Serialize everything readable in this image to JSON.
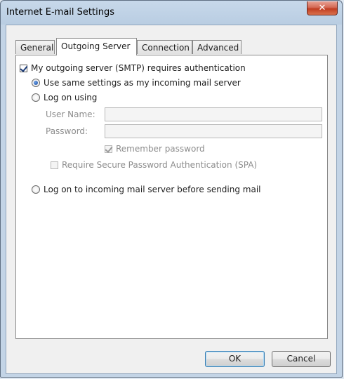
{
  "window": {
    "title": "Internet E-mail Settings",
    "close_glyph": "✕"
  },
  "tabs": [
    {
      "label": "General",
      "active": false
    },
    {
      "label": "Outgoing Server",
      "active": true
    },
    {
      "label": "Connection",
      "active": false
    },
    {
      "label": "Advanced",
      "active": false
    }
  ],
  "outgoing": {
    "smtp_auth": {
      "label": "My outgoing server (SMTP) requires authentication",
      "checked": true
    },
    "same_settings": {
      "label": "Use same settings as my incoming mail server",
      "selected": true
    },
    "log_on_using": {
      "label": "Log on using",
      "selected": false
    },
    "user_name": {
      "label": "User Name:",
      "value": ""
    },
    "password": {
      "label": "Password:",
      "value": ""
    },
    "remember_password": {
      "label": "Remember password",
      "checked": true,
      "enabled": false
    },
    "require_spa": {
      "label": "Require Secure Password Authentication (SPA)",
      "checked": false,
      "enabled": false
    },
    "log_on_incoming": {
      "label": "Log on to incoming mail server before sending mail",
      "selected": false
    }
  },
  "buttons": {
    "ok": "OK",
    "cancel": "Cancel"
  }
}
